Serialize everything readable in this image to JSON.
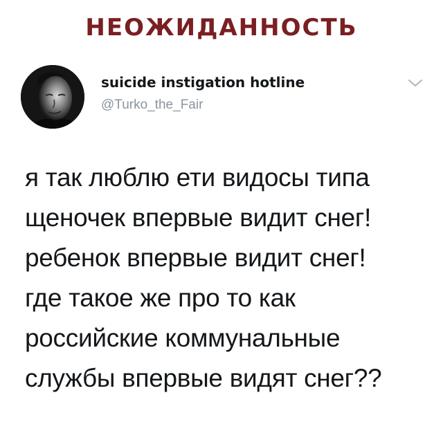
{
  "header": {
    "title": "НЕОЖИДАННОСТЬ"
  },
  "tweet": {
    "avatar_icon": "profile-photo",
    "author": {
      "name": "suicide instigation hotline",
      "handle": "@Turko_the_Fair"
    },
    "menu_icon": "chevron-down-icon",
    "text_lines": [
      "я так люблю ети видосы типа",
      "щеночек впервые видит снег!",
      "ребенок впервые видит снег!",
      "где такое же про то как",
      "российские коммунальные",
      "службы впервые видят снег??"
    ]
  },
  "colors": {
    "header_title": "#7a1f22",
    "text_primary": "#14171a",
    "text_secondary": "#8a949e",
    "chevron": "#aab8c2"
  }
}
